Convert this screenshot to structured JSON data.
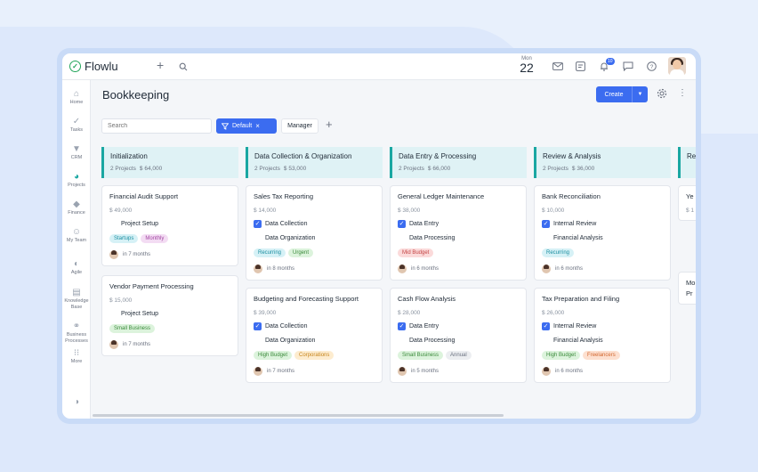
{
  "app": {
    "name": "Flowlu"
  },
  "topbar": {
    "month": "Mon",
    "day": "22",
    "notif_count": "10"
  },
  "sidebar": {
    "items": [
      {
        "label": "Home",
        "icon": "home-icon"
      },
      {
        "label": "Tasks",
        "icon": "tasks-icon"
      },
      {
        "label": "CRM",
        "icon": "crm-icon"
      },
      {
        "label": "Projects",
        "icon": "projects-icon"
      },
      {
        "label": "Finance",
        "icon": "finance-icon"
      },
      {
        "label": "My Team",
        "icon": "team-icon"
      },
      {
        "label": "Agile",
        "icon": "agile-icon"
      },
      {
        "label": "Knowledge Base",
        "icon": "knowledge-icon"
      },
      {
        "label": "Business Processes",
        "icon": "process-icon"
      },
      {
        "label": "More",
        "icon": "more-icon"
      }
    ]
  },
  "page": {
    "title": "Bookkeeping",
    "create_label": "Create"
  },
  "filters": {
    "search_placeholder": "Search",
    "active_filter": "Default",
    "manager_label": "Manager"
  },
  "columns": [
    {
      "title": "Initialization",
      "projects": "2 Projects",
      "amount": "$ 64,000",
      "cards": [
        {
          "title": "Financial Audit Support",
          "amount": "$ 49,000",
          "tasks": [
            {
              "label": "Project Setup",
              "checked": false
            }
          ],
          "tags": [
            {
              "label": "Startups",
              "bg": "#d6f1f6",
              "fg": "#1b8ea0"
            },
            {
              "label": "Monthly",
              "bg": "#f3dcf3",
              "fg": "#a347a3"
            }
          ],
          "due": "in 7 months"
        },
        {
          "title": "Vendor Payment Processing",
          "amount": "$ 15,000",
          "tasks": [
            {
              "label": "Project Setup",
              "checked": false
            }
          ],
          "tags": [
            {
              "label": "Small Business",
              "bg": "#dcf3dc",
              "fg": "#3a8a3a"
            }
          ],
          "due": "in 7 months"
        }
      ]
    },
    {
      "title": "Data Collection & Organization",
      "projects": "2 Projects",
      "amount": "$ 53,000",
      "cards": [
        {
          "title": "Sales Tax Reporting",
          "amount": "$ 14,000",
          "tasks": [
            {
              "label": "Data Collection",
              "checked": true
            },
            {
              "label": "Data Organization",
              "checked": false
            }
          ],
          "tags": [
            {
              "label": "Recurring",
              "bg": "#d6f1f6",
              "fg": "#1b8ea0"
            },
            {
              "label": "Urgent",
              "bg": "#dcf3dc",
              "fg": "#3a8a3a"
            }
          ],
          "due": "in 8 months"
        },
        {
          "title": "Budgeting and Forecasting Support",
          "amount": "$ 39,000",
          "tasks": [
            {
              "label": "Data Collection",
              "checked": true
            },
            {
              "label": "Data Organization",
              "checked": false
            }
          ],
          "tags": [
            {
              "label": "High Budget",
              "bg": "#dcf3dc",
              "fg": "#3a8a3a"
            },
            {
              "label": "Corporations",
              "bg": "#fdeccf",
              "fg": "#c6841b"
            }
          ],
          "due": "in 7 months"
        }
      ]
    },
    {
      "title": "Data Entry & Processing",
      "projects": "2 Projects",
      "amount": "$ 66,000",
      "cards": [
        {
          "title": "General Ledger Maintenance",
          "amount": "$ 38,000",
          "tasks": [
            {
              "label": "Data Entry",
              "checked": true
            },
            {
              "label": "Data Processing",
              "checked": false
            }
          ],
          "tags": [
            {
              "label": "Mid Budget",
              "bg": "#fbdada",
              "fg": "#c44545"
            }
          ],
          "due": "in 6 months"
        },
        {
          "title": "Cash Flow Analysis",
          "amount": "$ 28,000",
          "tasks": [
            {
              "label": "Data Entry",
              "checked": true
            },
            {
              "label": "Data Processing",
              "checked": false
            }
          ],
          "tags": [
            {
              "label": "Small Business",
              "bg": "#dcf3dc",
              "fg": "#3a8a3a"
            },
            {
              "label": "Annual",
              "bg": "#eceef1",
              "fg": "#6b7280"
            }
          ],
          "due": "in 5 months"
        }
      ]
    },
    {
      "title": "Review & Analysis",
      "projects": "2 Projects",
      "amount": "$ 36,000",
      "cards": [
        {
          "title": "Bank Reconciliation",
          "amount": "$ 10,000",
          "tasks": [
            {
              "label": "Internal Review",
              "checked": true
            },
            {
              "label": "Financial Analysis",
              "checked": false
            }
          ],
          "tags": [
            {
              "label": "Recurring",
              "bg": "#d6f1f6",
              "fg": "#1b8ea0"
            }
          ],
          "due": "in 6 months"
        },
        {
          "title": "Tax Preparation and Filing",
          "amount": "$ 26,000",
          "tasks": [
            {
              "label": "Internal Review",
              "checked": true
            },
            {
              "label": "Financial Analysis",
              "checked": false
            }
          ],
          "tags": [
            {
              "label": "High Budget",
              "bg": "#dcf3dc",
              "fg": "#3a8a3a"
            },
            {
              "label": "Freelancers",
              "bg": "#fde0d0",
              "fg": "#d2672f"
            }
          ],
          "due": "in 6 months"
        }
      ]
    },
    {
      "title": "Re",
      "cards": [
        {
          "title": "Ye",
          "amount": "$ 1"
        },
        {
          "title": "Mo",
          "title2": "Pr"
        }
      ]
    }
  ]
}
